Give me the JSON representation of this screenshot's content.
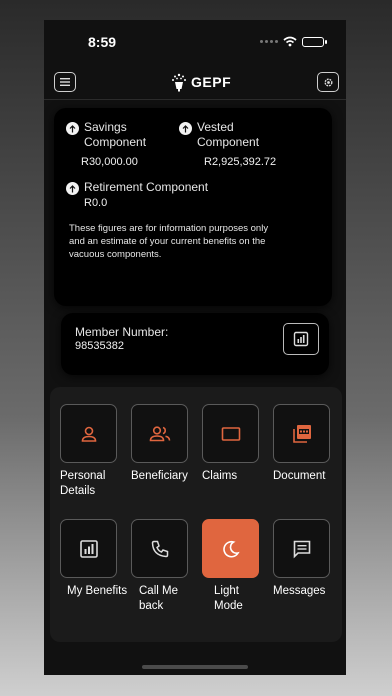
{
  "status_bar": {
    "time": "8:59"
  },
  "header": {
    "brand": "GEPF",
    "menu_icon": "hamburger-icon",
    "settings_icon": "gear-icon"
  },
  "components": {
    "savings": {
      "label": "Savings Component",
      "value": "R30,000.00"
    },
    "vested": {
      "label": "Vested Component",
      "value": "R2,925,392.72"
    },
    "retirement": {
      "label": "Retirement Component",
      "value": "R0.0"
    },
    "disclaimer": "These figures are for information purposes only and an estimate of your current benefits on the vacuous components."
  },
  "member": {
    "label": "Member Number:",
    "number": "98535382"
  },
  "tiles": [
    {
      "label": "Personal Details",
      "icon": "person-icon"
    },
    {
      "label": "Beneficiary",
      "icon": "people-icon"
    },
    {
      "label": "Claims",
      "icon": "rectangle-icon"
    },
    {
      "label": "Document",
      "icon": "pdf-icon"
    },
    {
      "label": "My Benefits",
      "icon": "chart-icon"
    },
    {
      "label": "Call Me back",
      "icon": "phone-icon"
    },
    {
      "label": "Light Mode",
      "icon": "moon-icon",
      "active": true
    },
    {
      "label": "Messages",
      "icon": "message-icon"
    }
  ],
  "colors": {
    "accent": "#e0663f",
    "background": "#111111",
    "card": "#000000"
  }
}
